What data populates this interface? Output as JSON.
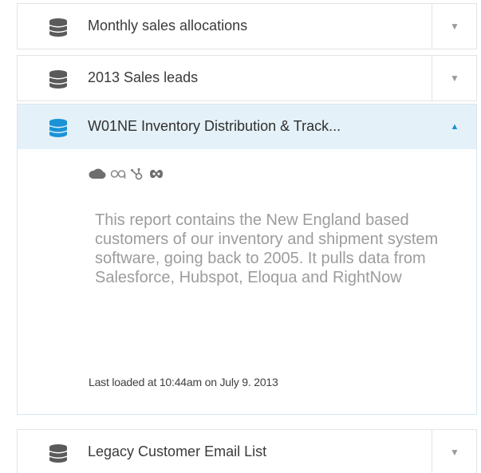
{
  "datasets": [
    {
      "name": "Monthly sales allocations",
      "toggle_icon": "▼",
      "db_icon_color": "#5a5a5a"
    },
    {
      "name": "2013 Sales leads",
      "toggle_icon": "▼",
      "db_icon_color": "#5a5a5a"
    },
    {
      "name": "W01NE Inventory Distribution & Track...",
      "toggle_icon": "▲",
      "expanded": true,
      "db_icon_color": "#1a93d6",
      "source_icons": [
        "salesforce-icon",
        "infinity-icon",
        "hubspot-icon",
        "rightnow-icon"
      ],
      "description": "This report contains the New England based customers of our inventory and shipment system software, going back to 2005.  It pulls data from Salesforce, Hubspot, Eloqua and RightNow",
      "last_loaded": "Last loaded at 10:44am on July 9. 2013"
    },
    {
      "name": "Legacy Customer Email List",
      "toggle_icon": "▼",
      "db_icon_color": "#5a5a5a"
    }
  ],
  "colors": {
    "row_border": "#e3e3e3",
    "expanded_header_bg": "#e4f1f8",
    "accent": "#1d8fd1",
    "description_text": "#9c9c9c"
  }
}
